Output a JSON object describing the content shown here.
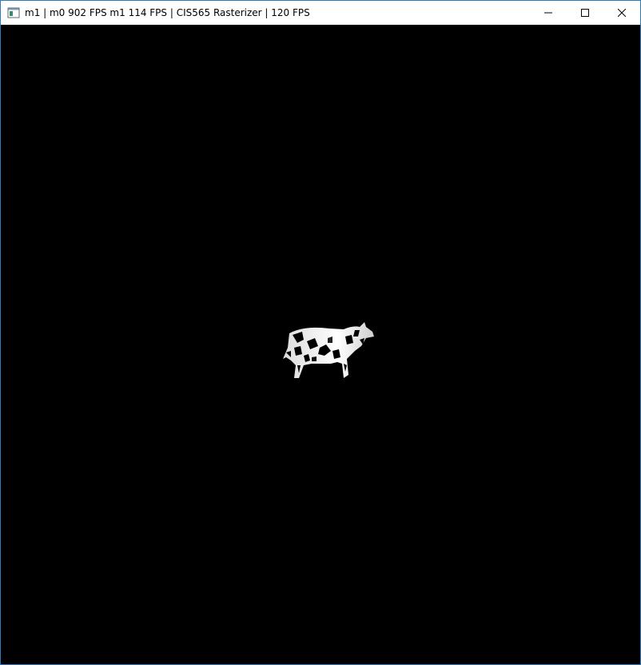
{
  "window": {
    "title": "m1 | m0 902 FPS m1 114 FPS | CIS565 Rasterizer | 120 FPS",
    "icon": "app-window-icon",
    "controls": {
      "minimize": "minimize-icon",
      "maximize": "maximize-icon",
      "close": "close-icon"
    }
  },
  "viewport": {
    "background": "#000000",
    "model": "cow",
    "model_color": "#ffffff"
  }
}
